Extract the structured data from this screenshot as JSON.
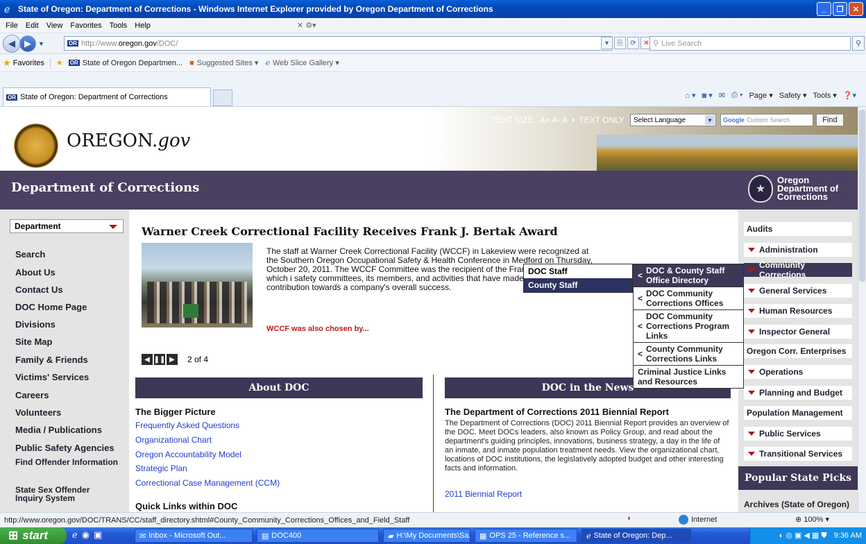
{
  "window": {
    "title": "State of Oregon: Department of Corrections - Windows Internet Explorer provided by Oregon Department of Corrections"
  },
  "menubar": {
    "items": [
      "File",
      "Edit",
      "View",
      "Favorites",
      "Tools",
      "Help"
    ]
  },
  "address": {
    "url_prefix": "http://www.",
    "url_host": "oregon.gov",
    "url_path": "/DOC/",
    "search_placeholder": "Live Search",
    "favicon_text": "OR"
  },
  "favorites": {
    "label": "Favorites",
    "items": [
      "State of Oregon Departmen...",
      "Suggested Sites ▾",
      "Web Slice Gallery ▾"
    ]
  },
  "tabs": {
    "active": "State of Oregon: Department of Corrections"
  },
  "commandbar": {
    "items": [
      "Page ▾",
      "Safety ▾",
      "Tools ▾"
    ]
  },
  "header": {
    "site_name_a": "OREGON.",
    "site_name_b": "gov",
    "text_size_label": "TEXT SIZE:",
    "text_size_controls": "A+ A- A",
    "text_only": "TEXT ONLY",
    "language_select": "Select Language",
    "search_placeholder": "Custom Search",
    "search_google": "Google",
    "find_button": "Find"
  },
  "dept_band": {
    "title": "Department of Corrections",
    "logo_lines": [
      "Oregon",
      "Department of",
      "Corrections"
    ]
  },
  "leftnav": {
    "dropdown": "Department",
    "items": [
      "Search",
      "About Us",
      "Contact Us",
      "DOC Home Page",
      "Divisions",
      "Site Map",
      "Family & Friends",
      "Victims' Services",
      "Careers",
      "Volunteers",
      "Media / Publications",
      "Public Safety Agencies",
      "Find Offender Information",
      "State Sex Offender Inquiry System"
    ]
  },
  "feature": {
    "headline": "Warner Creek Correctional Facility Receives Frank J. Bertak Award",
    "body": "The staff at Warner Creek Correctional Facility (WCCF) in Lakeview were recognized at the Southern Oregon Occupational Safety & Health Conference in Medford on Thursday, October 20, 2011. The WCCF Committee was the recipient of the Frank J. Bertak Award which i safety committees, its members, and activities that have made a significant contribution towards a company's overall success.",
    "more_link": "WCCF was also chosen by...",
    "pager_count": "2 of 4"
  },
  "about": {
    "bar": "About DOC",
    "subheading": "The Bigger Picture",
    "links": [
      "Frequently Asked Questions",
      "Organizational Chart",
      "Oregon Accountability Model",
      "Strategic Plan",
      "Correctional Case Management (CCM)"
    ],
    "quick_links": "Quick Links within DOC"
  },
  "news": {
    "bar": "DOC in the News",
    "subheading": "The Department of Corrections 2011 Biennial Report",
    "body": "The Department of Corrections (DOC) 2011 Biennial Report provides an overview of the DOC. Meet DOCs leaders, also known as Policy Group, and read about the department's guiding principles, innovations, business strategy, a day in the life of an inmate, and inmate population treatment needs. View the organizational chart, locations of DOC institutions, the legislatively adopted budget and other interesting facts and information.",
    "link": "2011 Biennial Report"
  },
  "rightnav": {
    "items": [
      {
        "label": "Audits",
        "arrow": false,
        "active": false
      },
      {
        "label": "Administration",
        "arrow": true,
        "active": false
      },
      {
        "label": "Community Corrections",
        "arrow": true,
        "active": true
      },
      {
        "label": "General Services",
        "arrow": true,
        "active": false
      },
      {
        "label": "Human Resources",
        "arrow": true,
        "active": false
      },
      {
        "label": "Inspector General",
        "arrow": true,
        "active": false
      },
      {
        "label": "Oregon Corr. Enterprises",
        "arrow": false,
        "active": false
      },
      {
        "label": "Operations",
        "arrow": true,
        "active": false
      },
      {
        "label": "Planning and Budget",
        "arrow": true,
        "active": false
      },
      {
        "label": "Population Management",
        "arrow": false,
        "active": false
      },
      {
        "label": "Public Services",
        "arrow": true,
        "active": false
      },
      {
        "label": "Transitional Services",
        "arrow": true,
        "active": false
      }
    ],
    "popular": "Popular State Picks",
    "archives": "Archives (State of Oregon)"
  },
  "flyout1": {
    "items": [
      "DOC Staff",
      "County Staff"
    ]
  },
  "flyout2": {
    "items": [
      "DOC & County Staff Office Directory",
      "DOC Community Corrections Offices",
      "DOC Community Corrections Program Links",
      "County Community Corrections Links",
      "Criminal Justice Links and Resources"
    ]
  },
  "statusbar": {
    "url": "http://www.oregon.gov/DOC/TRANS/CC/staff_directory.shtml#County_Community_Corrections_Offices_and_Field_Staff",
    "zone": "Internet",
    "zoom": "100%"
  },
  "taskbar": {
    "start": "start",
    "tasks": [
      "Inbox - Microsoft Out...",
      "DOC400",
      "H:\\My Documents\\Sa...",
      "OPS 25 - Reference s...",
      "State of Oregon: Dep..."
    ],
    "clock": "9:36 AM"
  }
}
